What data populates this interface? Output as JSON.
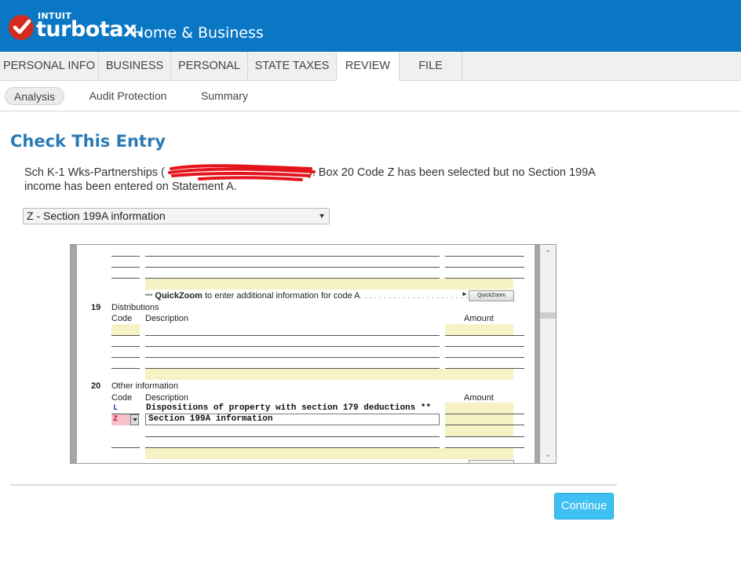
{
  "header": {
    "brand_small": "INTUIT",
    "brand": "turbotax.",
    "product": "Home & Business"
  },
  "tabs": [
    {
      "label": "PERSONAL INFO"
    },
    {
      "label": "BUSINESS"
    },
    {
      "label": "PERSONAL"
    },
    {
      "label": "STATE TAXES"
    },
    {
      "label": "REVIEW",
      "active": true
    },
    {
      "label": "FILE"
    }
  ],
  "subtabs": [
    {
      "label": "Analysis",
      "active": true
    },
    {
      "label": "Audit Protection"
    },
    {
      "label": "Summary"
    }
  ],
  "page": {
    "title": "Check This Entry",
    "message_prefix": "Sch K-1 Wks-Partnerships (",
    "message_suffix": "). Box 20 Code Z has been selected but no Section 199A income has been entered on Statement A."
  },
  "select": {
    "value": "Z - Section 199A information"
  },
  "form": {
    "quickzoom_prefix": "***",
    "quickzoom_bold": "QuickZoom",
    "quickzoom_text": "to enter additional information for code A",
    "quickzoom_dots": ". . . . . . . . . . . . . . . . . . . . . . . .",
    "quickzoom_button": "QuickZoom",
    "line19_num": "19",
    "line19_label": "Distributions",
    "line20_num": "20",
    "line20_label": "Other information",
    "col_code": "Code",
    "col_description": "Description",
    "col_amount": "Amount",
    "row_l_code": "L",
    "row_l_desc": "Dispositions of property with section 179 deductions **",
    "row_z_code": "Z",
    "row_z_desc": "Section 199A information"
  },
  "actions": {
    "continue": "Continue"
  },
  "colors": {
    "header": "#0a77c5",
    "title": "#2a7ab5",
    "continue": "#3ec0f2",
    "highlight": "#f7f2c4"
  }
}
